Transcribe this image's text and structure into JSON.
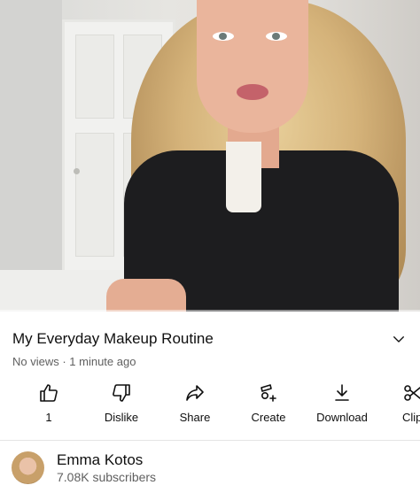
{
  "video": {
    "title": "My Everyday Makeup Routine",
    "meta": "No views · 1 minute ago"
  },
  "actions": [
    {
      "label": "1",
      "icon": "thumbs-up-icon"
    },
    {
      "label": "Dislike",
      "icon": "thumbs-down-icon"
    },
    {
      "label": "Share",
      "icon": "share-arrow-icon"
    },
    {
      "label": "Create",
      "icon": "create-remix-icon"
    },
    {
      "label": "Download",
      "icon": "download-icon"
    },
    {
      "label": "Clip",
      "icon": "scissors-icon"
    }
  ],
  "channel": {
    "name": "Emma Kotos",
    "subscribers": "7.08K subscribers"
  },
  "colors": {
    "text_primary": "#0f0f0f",
    "text_secondary": "#606060",
    "background": "#ffffff"
  }
}
